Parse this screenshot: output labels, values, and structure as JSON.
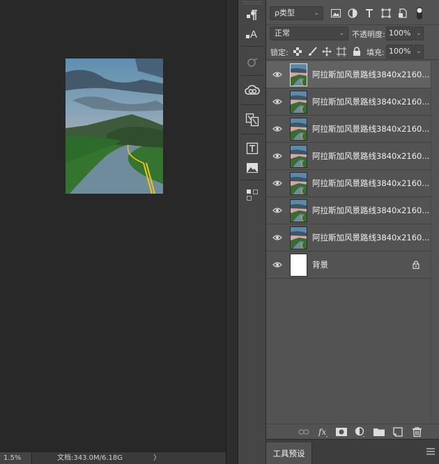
{
  "status": {
    "zoom": "1.5%",
    "doc_size": "文档:343.0M/6.18G",
    "arrow": "〉"
  },
  "layers_panel": {
    "filter": {
      "kind_label": "ρ类型",
      "caret": "⌄"
    },
    "blend_mode": "正常",
    "opacity_label": "不透明度:",
    "opacity_value": "100%",
    "lock_label": "锁定:",
    "fill_label": "填充:",
    "fill_value": "100%",
    "layers": [
      {
        "name": "阿拉斯加风景路线3840x2160...",
        "selected": true,
        "type": "image"
      },
      {
        "name": "阿拉斯加风景路线3840x2160...",
        "selected": false,
        "type": "image"
      },
      {
        "name": "阿拉斯加风景路线3840x2160...",
        "selected": false,
        "type": "image"
      },
      {
        "name": "阿拉斯加风景路线3840x2160...",
        "selected": false,
        "type": "image"
      },
      {
        "name": "阿拉斯加风景路线3840x2160...",
        "selected": false,
        "type": "image"
      },
      {
        "name": "阿拉斯加风景路线3840x2160...",
        "selected": false,
        "type": "image"
      },
      {
        "name": "阿拉斯加风景路线3840x2160...",
        "selected": false,
        "type": "image"
      },
      {
        "name": "背景",
        "selected": false,
        "type": "background",
        "locked": true
      }
    ],
    "footer_icons": [
      "link-icon",
      "fx-icon",
      "mask-icon",
      "adjustment-icon",
      "folder-icon",
      "new-layer-icon",
      "trash-icon"
    ]
  },
  "presets": {
    "tab_label": "工具预设"
  },
  "dock_icons": [
    "paragraph-icon",
    "character-icon",
    "libraries-icon",
    "creative-cloud-icon",
    "glyphs-icon",
    "text-frame-icon",
    "image-icon",
    "artboard-icon"
  ],
  "colors": {
    "canvas_bg": "#282828",
    "panel_bg": "#535353",
    "selected_row": "#626262"
  }
}
